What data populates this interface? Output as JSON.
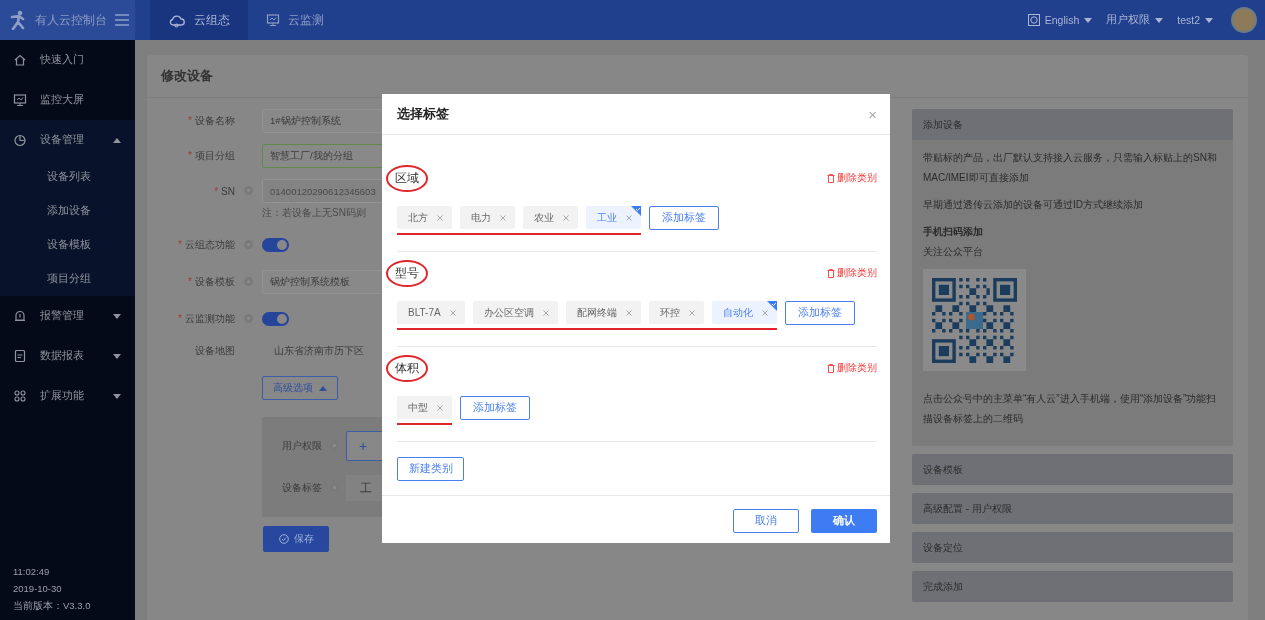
{
  "header": {
    "brand": "有人云控制台",
    "tabs": [
      {
        "label": "云组态",
        "selected": true
      },
      {
        "label": "云监测",
        "selected": false
      }
    ],
    "language": "English",
    "permission_menu": "用户权限",
    "user": "test2"
  },
  "sidebar": {
    "items": [
      {
        "label": "快速入门"
      },
      {
        "label": "监控大屏"
      },
      {
        "label": "设备管理",
        "expanded": true,
        "children": [
          {
            "label": "设备列表"
          },
          {
            "label": "添加设备"
          },
          {
            "label": "设备模板"
          },
          {
            "label": "项目分组"
          }
        ]
      },
      {
        "label": "报警管理",
        "expanded": false
      },
      {
        "label": "数据报表",
        "expanded": false
      },
      {
        "label": "扩展功能",
        "expanded": false
      }
    ],
    "footer": [
      "11:02:49",
      "2019-10-30",
      "当前版本：V3.3.0"
    ]
  },
  "page": {
    "title": "修改设备",
    "form": {
      "fields": [
        {
          "kind": "input",
          "required_mark": "*",
          "label": "设备名称",
          "help": false,
          "value": "1#锅炉控制系统"
        },
        {
          "kind": "input",
          "required_mark": "*",
          "label": "项目分组",
          "help": false,
          "value": "智慧工厂/我的分组",
          "valid": true
        },
        {
          "kind": "input",
          "required_mark": "*",
          "label": "SN",
          "help": true,
          "value": "01400120290612345603",
          "disabled": true,
          "note": "注：若设备上无SN码则"
        },
        {
          "kind": "switch",
          "required_mark": "*",
          "label": "云组态功能",
          "help": true,
          "on": true
        },
        {
          "kind": "input",
          "required_mark": "*",
          "label": "设备模板",
          "help": true,
          "value": "锅炉控制系统模板"
        },
        {
          "kind": "switch",
          "required_mark": "*",
          "label": "云监测功能",
          "help": true,
          "on": true
        },
        {
          "kind": "text",
          "label": "设备地图",
          "help": false,
          "value": "山东省济南市历下区"
        }
      ],
      "advanced_button": "高级选项",
      "advanced_expanded": true,
      "advanced_rows": [
        {
          "kind": "button",
          "label": "用户权限",
          "help": true,
          "value": "+"
        },
        {
          "kind": "tag",
          "label": "设备标签",
          "help": true,
          "value": "工"
        }
      ],
      "save_button": "保存"
    },
    "side_panel": {
      "sections": [
        {
          "title": "添加设备",
          "content": [
            {
              "kind": "text",
              "text": "带贴标的产品，出厂默认支持接入云服务，只需输入标贴上的SN和MAC/IMEI即可直接添加"
            },
            {
              "kind": "text",
              "text": "早期通过透传云添加的设备可通过ID方式继续添加"
            },
            {
              "kind": "heading",
              "text": "手机扫码添加"
            },
            {
              "kind": "text",
              "text": "关注公众平台"
            },
            {
              "kind": "qr"
            },
            {
              "kind": "text",
              "text": "点击公众号中的主菜单“有人云”进入手机端，使用“添加设备”功能扫描设备标签上的二维码"
            }
          ]
        },
        {
          "title": "设备模板"
        },
        {
          "title": "高级配置 - 用户权限"
        },
        {
          "title": "设备定位"
        },
        {
          "title": "完成添加"
        }
      ]
    }
  },
  "dialog": {
    "title": "选择标签",
    "categories": [
      {
        "title": "区域",
        "annotated": true,
        "delete_label": "删除类别",
        "add_label": "添加标签",
        "tags": [
          {
            "label": "北方",
            "selected": false
          },
          {
            "label": "电力",
            "selected": false
          },
          {
            "label": "农业",
            "selected": false
          },
          {
            "label": "工业",
            "selected": true
          }
        ]
      },
      {
        "title": "型号",
        "annotated": true,
        "delete_label": "删除类别",
        "add_label": "添加标签",
        "tags": [
          {
            "label": "BLT-7A",
            "selected": false
          },
          {
            "label": "办公区空调",
            "selected": false
          },
          {
            "label": "配网终端",
            "selected": false
          },
          {
            "label": "环控",
            "selected": false
          },
          {
            "label": "自动化",
            "selected": true
          }
        ]
      },
      {
        "title": "体积",
        "annotated": true,
        "delete_label": "删除类别",
        "add_label": "添加标签",
        "tags": [
          {
            "label": "中型",
            "selected": false
          }
        ]
      }
    ],
    "new_category_button": "新建类别",
    "close_symbol": "×",
    "buttons": [
      {
        "label": "取消",
        "kind": "secondary"
      },
      {
        "label": "确认",
        "kind": "primary"
      }
    ]
  }
}
